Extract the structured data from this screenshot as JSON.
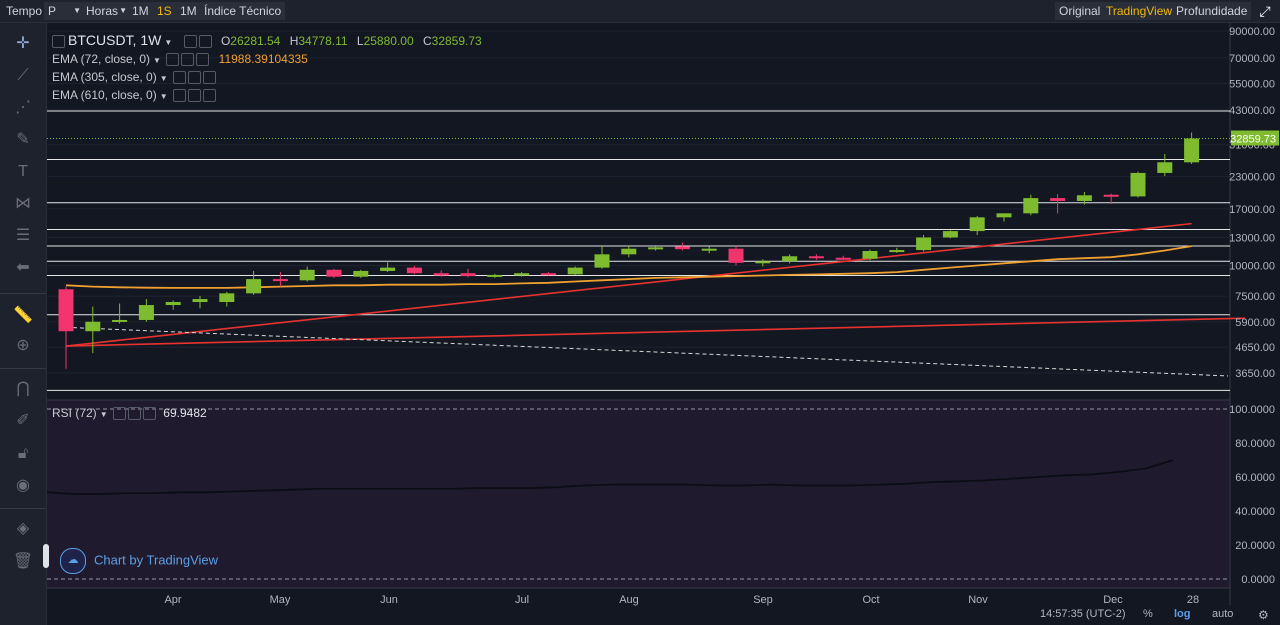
{
  "topbar": {
    "tempo": "Tempo",
    "period": "P",
    "horas": "Horas",
    "btn_1m": "1M",
    "btn_1s": "1S",
    "btn_1m_b": "1M",
    "indicators": "Índice Técnico",
    "view_original": "Original",
    "view_tradingview": "TradingView",
    "view_depth": "Profundidade"
  },
  "legend": {
    "symbol": "BTCUSDT, 1W",
    "o_label": "O",
    "o": "26281.54",
    "h_label": "H",
    "h": "34778.11",
    "l_label": "L",
    "l": "25880.00",
    "c_label": "C",
    "c": "32859.73",
    "ema1": "EMA (72, close, 0)",
    "ema1_value": "11988.39104335",
    "ema2": "EMA (305, close, 0)",
    "ema3": "EMA (610, close, 0)",
    "rsi": "RSI (72)",
    "rsi_value": "69.9482"
  },
  "watermark": "Chart by TradingView",
  "status": {
    "time": "14:57:35 (UTC-2)",
    "pct": "%",
    "log": "log",
    "auto": "auto"
  },
  "colors": {
    "up": "#7ebb2f",
    "down": "#f2356d",
    "ema72": "#f0a030",
    "trend": "#e8322f",
    "last_price_bg": "#7ebb2f"
  },
  "chart_data": [
    {
      "type": "candlestick",
      "title": "BTCUSDT, 1W",
      "scale": "log",
      "x_tick_labels": [
        "Apr",
        "May",
        "Jun",
        "Jul",
        "Aug",
        "Sep",
        "Oct",
        "Nov",
        "Dec",
        "28"
      ],
      "y_ticks": [
        90000,
        70000,
        55000,
        43000,
        31000,
        23000,
        17000,
        13000,
        10000,
        7500,
        5900,
        4650,
        3650
      ],
      "y_tick_labels": [
        "90000.00",
        "70000.00",
        "55000.00",
        "43000.00",
        "31000.00",
        "23000.00",
        "17000.00",
        "13000.00",
        "10000.00",
        "7500.00",
        "5900.00",
        "4650.00",
        "3650.00"
      ],
      "last_price": "32859.73",
      "horizontal_levels": [
        42500,
        27000,
        18000,
        14000,
        12000,
        10400,
        9100,
        6300,
        3100
      ],
      "candles": [
        {
          "o": 8000,
          "h": 8200,
          "l": 3800,
          "c": 5400
        },
        {
          "o": 5400,
          "h": 6800,
          "l": 4400,
          "c": 5900
        },
        {
          "o": 5900,
          "h": 7000,
          "l": 5800,
          "c": 6000
        },
        {
          "o": 6000,
          "h": 7300,
          "l": 5900,
          "c": 6900
        },
        {
          "o": 6900,
          "h": 7200,
          "l": 6600,
          "c": 7100
        },
        {
          "o": 7100,
          "h": 7500,
          "l": 6700,
          "c": 7300
        },
        {
          "o": 7100,
          "h": 7800,
          "l": 6800,
          "c": 7700
        },
        {
          "o": 7700,
          "h": 9500,
          "l": 7600,
          "c": 8800
        },
        {
          "o": 8800,
          "h": 9400,
          "l": 8200,
          "c": 8700
        },
        {
          "o": 8700,
          "h": 9900,
          "l": 8600,
          "c": 9600
        },
        {
          "o": 9600,
          "h": 9700,
          "l": 8900,
          "c": 9000
        },
        {
          "o": 9000,
          "h": 9600,
          "l": 8900,
          "c": 9500
        },
        {
          "o": 9500,
          "h": 10300,
          "l": 9400,
          "c": 9800
        },
        {
          "o": 9800,
          "h": 9950,
          "l": 9200,
          "c": 9300
        },
        {
          "o": 9300,
          "h": 9550,
          "l": 9000,
          "c": 9100
        },
        {
          "o": 9300,
          "h": 9700,
          "l": 8950,
          "c": 9050
        },
        {
          "o": 9050,
          "h": 9250,
          "l": 8900,
          "c": 9150
        },
        {
          "o": 9100,
          "h": 9400,
          "l": 9000,
          "c": 9300
        },
        {
          "o": 9300,
          "h": 9400,
          "l": 9100,
          "c": 9200
        },
        {
          "o": 9200,
          "h": 9900,
          "l": 9150,
          "c": 9800
        },
        {
          "o": 9800,
          "h": 12100,
          "l": 9700,
          "c": 11100
        },
        {
          "o": 11100,
          "h": 12000,
          "l": 10800,
          "c": 11700
        },
        {
          "o": 11700,
          "h": 12100,
          "l": 11500,
          "c": 11850
        },
        {
          "o": 11950,
          "h": 12400,
          "l": 11500,
          "c": 11650
        },
        {
          "o": 11650,
          "h": 11950,
          "l": 11200,
          "c": 11700
        },
        {
          "o": 11700,
          "h": 12000,
          "l": 10000,
          "c": 10250
        },
        {
          "o": 10250,
          "h": 10600,
          "l": 9900,
          "c": 10400
        },
        {
          "o": 10400,
          "h": 11100,
          "l": 10200,
          "c": 10900
        },
        {
          "o": 10900,
          "h": 11100,
          "l": 10550,
          "c": 10750
        },
        {
          "o": 10750,
          "h": 10950,
          "l": 10500,
          "c": 10650
        },
        {
          "o": 10650,
          "h": 11600,
          "l": 10500,
          "c": 11450
        },
        {
          "o": 11450,
          "h": 11800,
          "l": 11250,
          "c": 11550
        },
        {
          "o": 11550,
          "h": 13300,
          "l": 11400,
          "c": 13000
        },
        {
          "o": 13000,
          "h": 13900,
          "l": 12900,
          "c": 13800
        },
        {
          "o": 13800,
          "h": 15900,
          "l": 13300,
          "c": 15700
        },
        {
          "o": 15700,
          "h": 16200,
          "l": 15100,
          "c": 16300
        },
        {
          "o": 16300,
          "h": 19400,
          "l": 16000,
          "c": 18800
        },
        {
          "o": 18800,
          "h": 19500,
          "l": 16300,
          "c": 18300
        },
        {
          "o": 18300,
          "h": 19900,
          "l": 17700,
          "c": 19300
        },
        {
          "o": 19400,
          "h": 19600,
          "l": 17800,
          "c": 19100
        },
        {
          "o": 19100,
          "h": 24100,
          "l": 18900,
          "c": 23800
        },
        {
          "o": 23800,
          "h": 28400,
          "l": 23100,
          "c": 26300
        },
        {
          "o": 26281.54,
          "h": 34778.11,
          "l": 25880.0,
          "c": 32859.73
        }
      ],
      "ema_72": [
        8300,
        8200,
        8150,
        8120,
        8100,
        8100,
        8100,
        8150,
        8200,
        8250,
        8300,
        8300,
        8350,
        8350,
        8350,
        8400,
        8400,
        8450,
        8500,
        8600,
        8700,
        8800,
        8900,
        8950,
        9000,
        9050,
        9100,
        9150,
        9200,
        9250,
        9300,
        9400,
        9600,
        9800,
        10000,
        10200,
        10400,
        10600,
        10700,
        10800,
        11100,
        11500,
        11988.39
      ],
      "trend_lines": [
        {
          "from": [
            0,
            4700
          ],
          "to": [
            42,
            14800
          ]
        },
        {
          "from": [
            0,
            4700
          ],
          "to": [
            44,
            6100
          ]
        }
      ],
      "dashed_line": {
        "from": [
          0,
          5600
        ],
        "to": [
          44,
          3550
        ]
      }
    },
    {
      "type": "line",
      "title": "RSI (72)",
      "last_value": "69.9482",
      "y_ticks": [
        100,
        80,
        60,
        40,
        20,
        0
      ],
      "y_tick_labels": [
        "100.0000",
        "80.0000",
        "60.0000",
        "40.0000",
        "20.0000",
        "0.0000"
      ],
      "ylim": [
        0,
        100
      ],
      "values": [
        51,
        50,
        50,
        50.5,
        50.5,
        51,
        51,
        51.5,
        52,
        52.5,
        53,
        53,
        53,
        53,
        53,
        53,
        53.5,
        53.5,
        53.5,
        54,
        55,
        55.5,
        55.5,
        55.5,
        55.5,
        55,
        55,
        55.5,
        55,
        55,
        55,
        55.5,
        56,
        57,
        57.5,
        58,
        59,
        60,
        61,
        61.5,
        63,
        65,
        69.9482
      ]
    }
  ]
}
